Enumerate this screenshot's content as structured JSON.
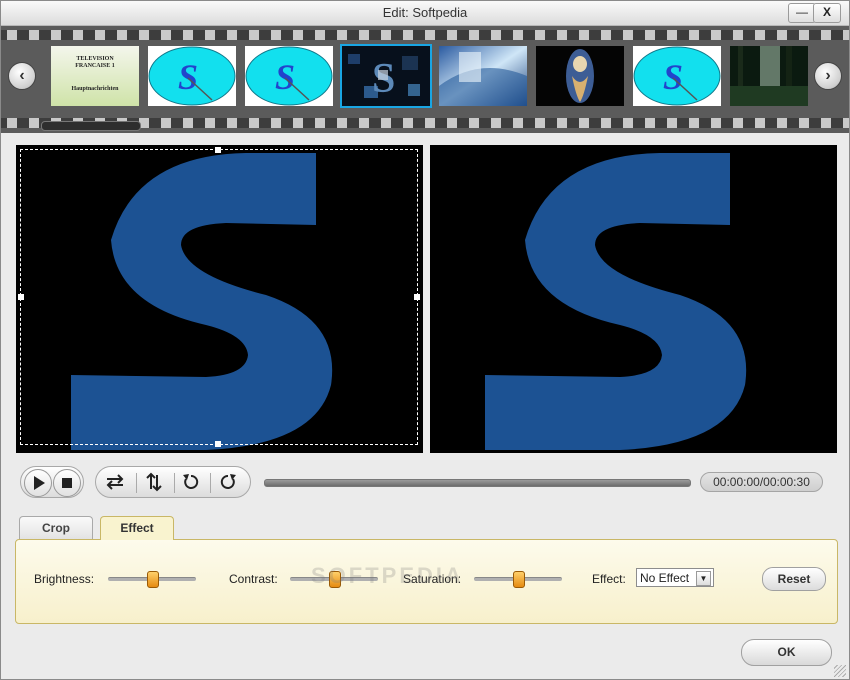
{
  "window": {
    "title": "Edit: Softpedia",
    "minimize_label": "—",
    "close_label": "X"
  },
  "filmstrip": {
    "prev_icon": "chevron-left-icon",
    "next_icon": "chevron-right-icon",
    "thumbnails": [
      {
        "kind": "tv-card",
        "lines": [
          "TELEVISION",
          "FRANCAISE 1",
          "Hauptnachrichten"
        ]
      },
      {
        "kind": "s-logo"
      },
      {
        "kind": "s-logo"
      },
      {
        "kind": "dark-collage",
        "selected": true
      },
      {
        "kind": "blue-abstract"
      },
      {
        "kind": "figure-dark"
      },
      {
        "kind": "s-logo"
      },
      {
        "kind": "forest"
      }
    ]
  },
  "preview": {
    "letter": "S",
    "color": "#1c5293"
  },
  "playback": {
    "time": "00:00:00/00:00:30",
    "progress": 0
  },
  "tabs": [
    {
      "label": "Crop"
    },
    {
      "label": "Effect",
      "active": true
    }
  ],
  "effect": {
    "brightness_label": "Brightness:",
    "brightness": 0.5,
    "contrast_label": "Contrast:",
    "contrast": 0.5,
    "saturation_label": "Saturation:",
    "saturation": 0.5,
    "effect_label": "Effect:",
    "effect_value": "No Effect",
    "reset_label": "Reset"
  },
  "watermark": "SOFTPEDIA",
  "ok_label": "OK",
  "colors": {
    "accent": "#19a6e4",
    "slider_knob": "#f0a020",
    "panel_border": "#c9b766"
  }
}
